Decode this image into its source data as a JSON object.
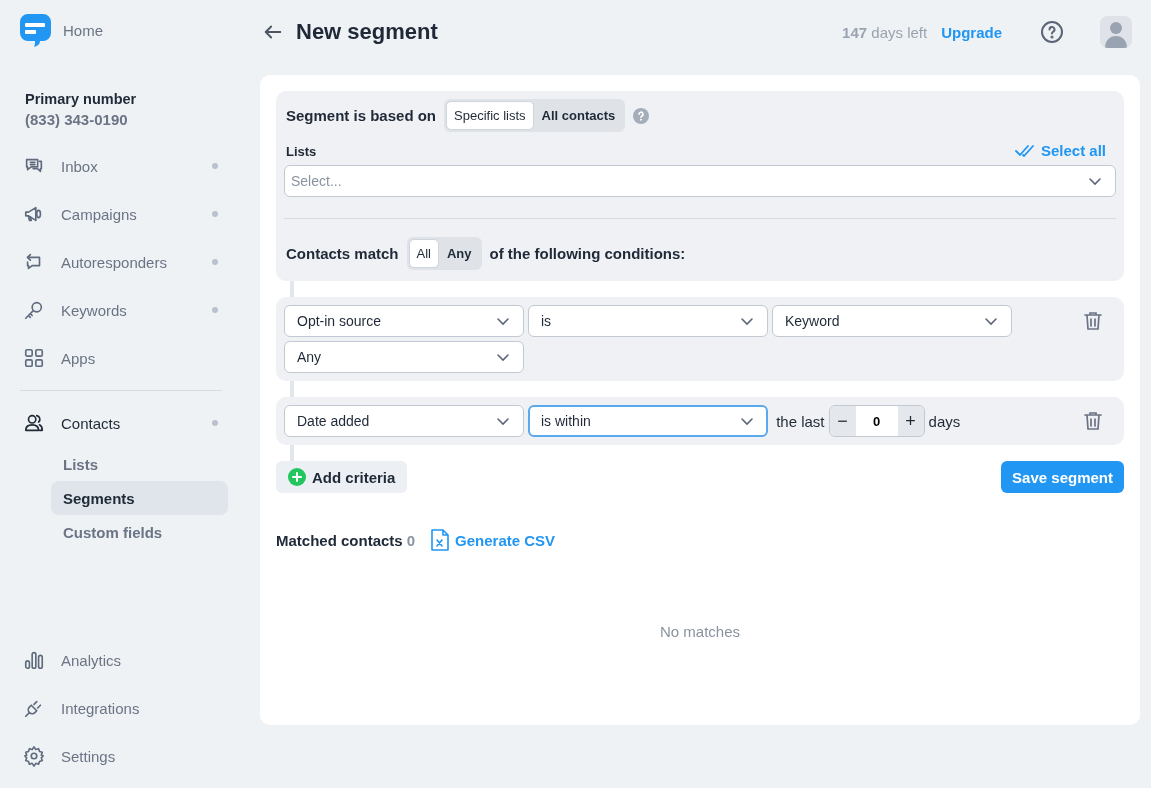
{
  "sidebar": {
    "home": "Home",
    "primary_number": {
      "label": "Primary number",
      "value": "(833) 343-0190"
    },
    "nav_top": [
      {
        "label": "Inbox",
        "kind": "inbox",
        "dot": true,
        "selected": false
      },
      {
        "label": "Campaigns",
        "kind": "campaigns",
        "dot": true,
        "selected": false
      },
      {
        "label": "Autoresponders",
        "kind": "autoresponders",
        "dot": true,
        "selected": false
      },
      {
        "label": "Keywords",
        "kind": "keywords",
        "dot": true,
        "selected": false
      },
      {
        "label": "Apps",
        "kind": "apps",
        "dot": false,
        "selected": false
      }
    ],
    "nav_contacts": [
      {
        "label": "Contacts",
        "kind": "contacts",
        "dot": true,
        "selected": true,
        "children": [
          {
            "label": "Lists",
            "selected": false
          },
          {
            "label": "Segments",
            "selected": true
          },
          {
            "label": "Custom fields",
            "selected": false
          }
        ]
      }
    ],
    "nav_bottom": [
      {
        "label": "Analytics",
        "kind": "analytics",
        "dot": false,
        "selected": false
      },
      {
        "label": "Integrations",
        "kind": "integrations",
        "dot": false,
        "selected": false
      },
      {
        "label": "Settings",
        "kind": "settings",
        "dot": false,
        "selected": false
      }
    ]
  },
  "header": {
    "title": "New segment",
    "trial": "**147** days left",
    "upgrade": "Upgrade"
  },
  "segment": {
    "based_on_label": "Segment is based on",
    "based_on_options": [
      {
        "label": "Specific lists",
        "selected": true
      },
      {
        "label": "All contacts",
        "selected": false
      }
    ],
    "lists_label": "Lists",
    "select_all": "Select all",
    "lists_placeholder": "Select...",
    "match_label": "Contacts match",
    "match_options": [
      {
        "label": "All",
        "selected": true
      },
      {
        "label": "Any",
        "selected": false
      }
    ],
    "match_suffix": "of the following conditions:"
  },
  "conditions": [
    {
      "selects": [
        {
          "value": "Opt-in source",
          "focused": false
        },
        {
          "value": "is",
          "focused": false
        },
        {
          "value": "Keyword",
          "focused": false
        },
        {
          "value": "Any",
          "focused": false
        }
      ]
    },
    {
      "selects": [
        {
          "value": "Date added",
          "focused": false
        },
        {
          "value": "is within",
          "focused": true
        }
      ],
      "range": {
        "prefix": "the last",
        "minus": "−",
        "value": "0",
        "plus": "+",
        "suffix": "days"
      }
    }
  ],
  "add_criteria": "Add criteria",
  "save": "Save segment",
  "matched": {
    "label": "Matched contacts",
    "count": "0",
    "generate": "Generate CSV",
    "empty": "No matches"
  }
}
